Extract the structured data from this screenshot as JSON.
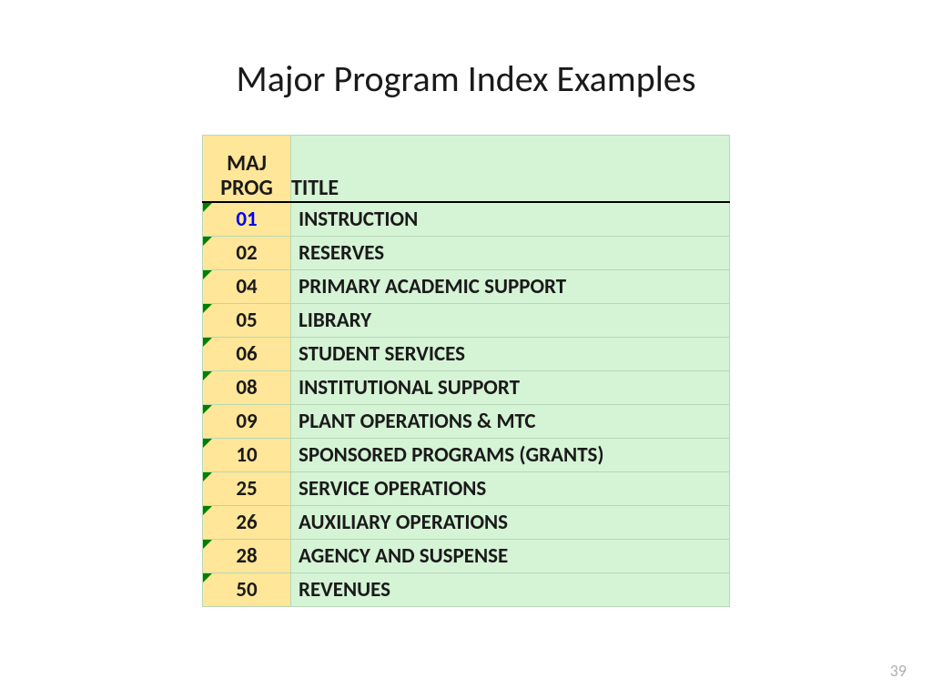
{
  "title": "Major Program Index Examples",
  "columns": {
    "code_line1": "MAJ",
    "code_line2": "PROG",
    "title": "TITLE"
  },
  "rows": [
    {
      "code": "01",
      "title": "INSTRUCTION",
      "highlight": true
    },
    {
      "code": "02",
      "title": "RESERVES",
      "highlight": false
    },
    {
      "code": "04",
      "title": "PRIMARY ACADEMIC SUPPORT",
      "highlight": false
    },
    {
      "code": "05",
      "title": "LIBRARY",
      "highlight": false
    },
    {
      "code": "06",
      "title": "STUDENT SERVICES",
      "highlight": false
    },
    {
      "code": "08",
      "title": "INSTITUTIONAL SUPPORT",
      "highlight": false
    },
    {
      "code": "09",
      "title": "PLANT OPERATIONS & MTC",
      "highlight": false
    },
    {
      "code": "10",
      "title": "SPONSORED PROGRAMS (GRANTS)",
      "highlight": false
    },
    {
      "code": "25",
      "title": "SERVICE OPERATIONS",
      "highlight": false
    },
    {
      "code": "26",
      "title": "AUXILIARY OPERATIONS",
      "highlight": false
    },
    {
      "code": "28",
      "title": "AGENCY AND SUSPENSE",
      "highlight": false
    },
    {
      "code": "50",
      "title": "REVENUES",
      "highlight": false
    }
  ],
  "page_number": "39"
}
